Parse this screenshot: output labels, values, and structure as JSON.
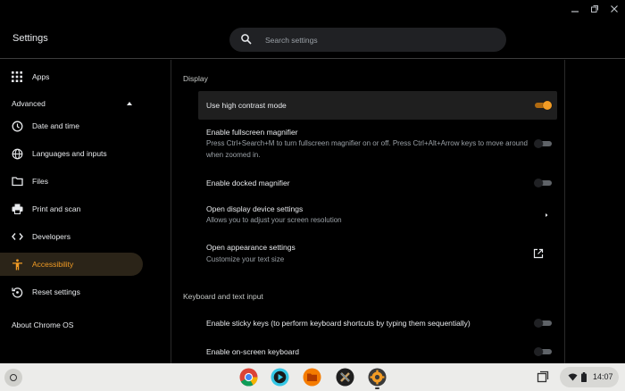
{
  "app": {
    "title": "Settings"
  },
  "search": {
    "placeholder": "Search settings"
  },
  "window_controls": [
    "minimize",
    "maximize",
    "close"
  ],
  "sidebar": {
    "apps": "Apps",
    "advanced": "Advanced",
    "items": [
      {
        "label": "Date and time",
        "icon": "clock-icon"
      },
      {
        "label": "Languages and inputs",
        "icon": "globe-icon"
      },
      {
        "label": "Files",
        "icon": "folder-icon"
      },
      {
        "label": "Print and scan",
        "icon": "printer-icon"
      },
      {
        "label": "Developers",
        "icon": "code-icon"
      },
      {
        "label": "Accessibility",
        "icon": "accessibility-icon",
        "active": true
      },
      {
        "label": "Reset settings",
        "icon": "reset-icon"
      }
    ],
    "about": "About Chrome OS"
  },
  "content": {
    "display_title": "Display",
    "rows": [
      {
        "title": "Use high contrast mode",
        "toggle": true
      },
      {
        "title": "Enable fullscreen magnifier",
        "subtitle": "Press Ctrl+Search+M to turn fullscreen magnifier on or off. Press Ctrl+Alt+Arrow keys to move around when zoomed in.",
        "toggle": false
      },
      {
        "title": "Enable docked magnifier",
        "toggle": false
      },
      {
        "title": "Open display device settings",
        "subtitle": "Allows you to adjust your screen resolution"
      },
      {
        "title": "Open appearance settings",
        "subtitle": "Customize your text size"
      }
    ],
    "keyboard_title": "Keyboard and text input",
    "keyboard_rows": [
      {
        "title": "Enable sticky keys (to perform keyboard shortcuts by typing them sequentially)",
        "toggle": false
      },
      {
        "title": "Enable on-screen keyboard",
        "toggle": false
      }
    ]
  },
  "colors": {
    "accent": "#f29c25",
    "background": "#000000",
    "active_bg": "#2b2418"
  },
  "shelf": {
    "apps": [
      "chrome-icon",
      "media-player-icon",
      "files-icon",
      "crossover-icon",
      "settings-app-icon"
    ],
    "time": "14:07"
  }
}
